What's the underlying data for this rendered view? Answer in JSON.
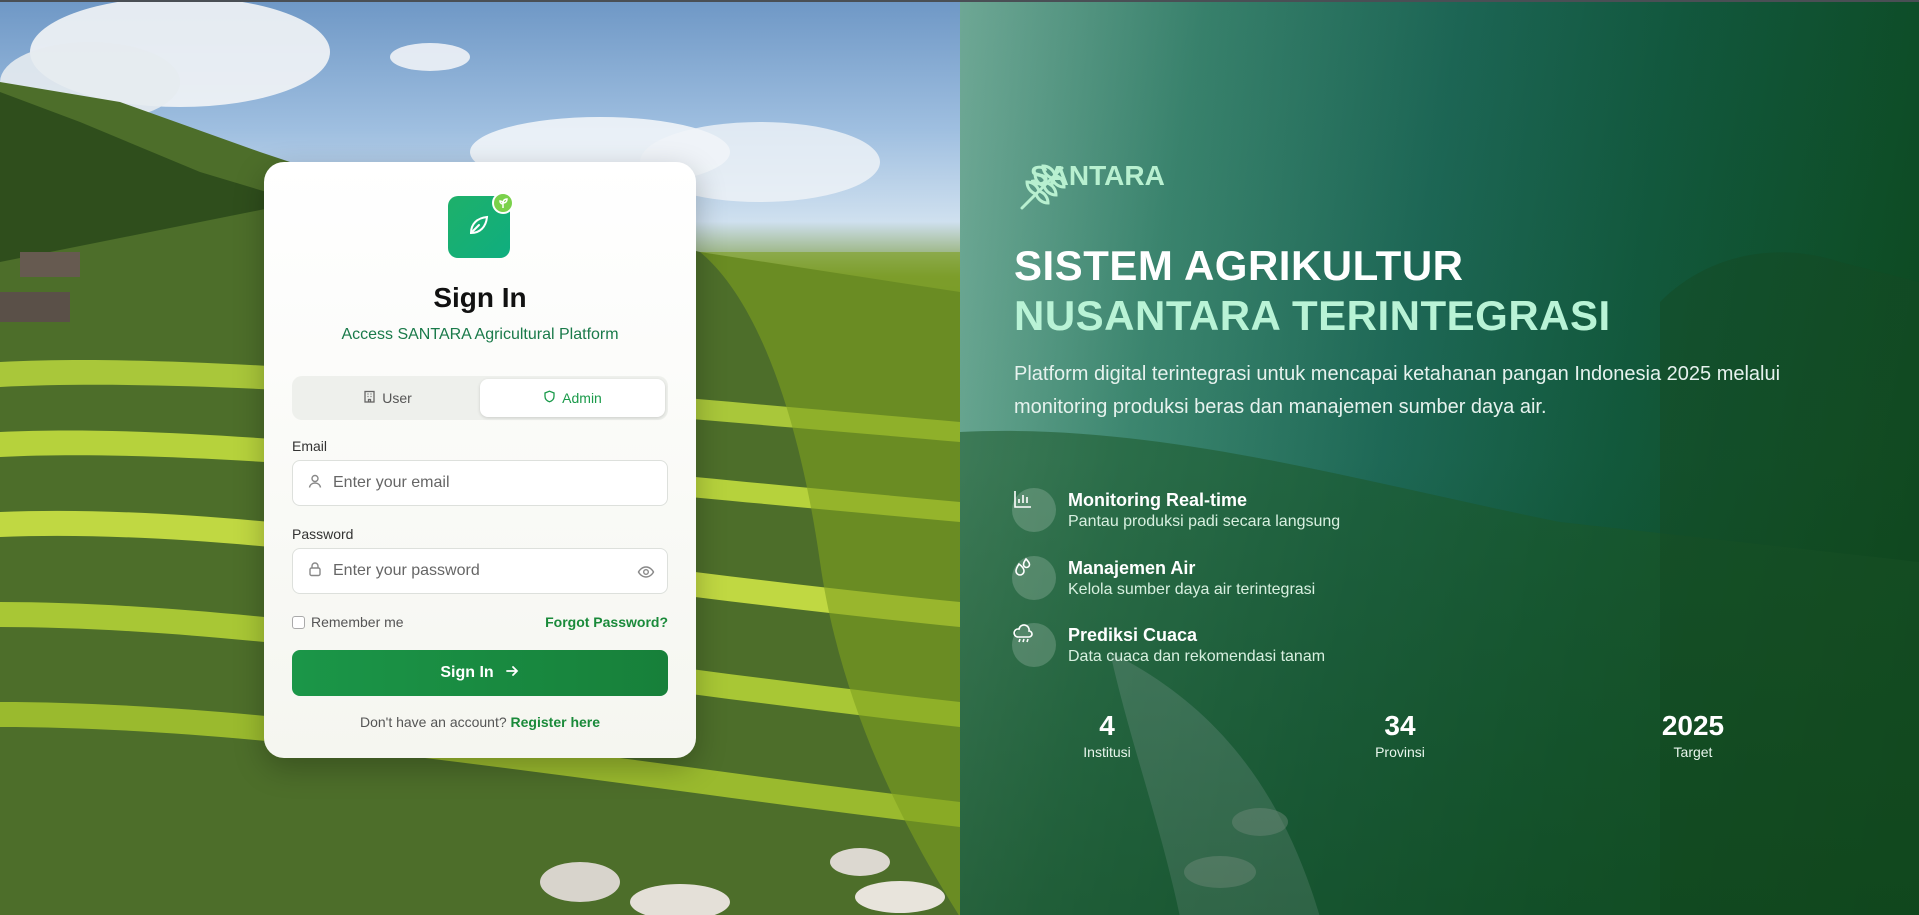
{
  "card": {
    "title": "Sign In",
    "subtitle": "Access SANTARA Agricultural Platform",
    "tabs": [
      {
        "label": "User",
        "icon": "building-icon",
        "active": false
      },
      {
        "label": "Admin",
        "icon": "shield-icon",
        "active": true
      }
    ],
    "email": {
      "label": "Email",
      "placeholder": "Enter your email"
    },
    "password": {
      "label": "Password",
      "placeholder": "Enter your password"
    },
    "remember": "Remember me",
    "forgot": "Forgot Password?",
    "signin": "Sign In",
    "register_prompt": "Don't have an account?",
    "register_link": "Register here"
  },
  "hero": {
    "brand": "SANTARA",
    "headline_1": "SISTEM AGRIKULTUR",
    "headline_2": "NUSANTARA TERINTEGRASI",
    "description": "Platform digital terintegrasi untuk mencapai ketahanan pangan Indonesia 2025 melalui monitoring produksi beras dan manajemen sumber daya air.",
    "features": [
      {
        "title": "Monitoring Real-time",
        "subtitle": "Pantau produksi padi secara langsung",
        "icon": "bar-chart-icon"
      },
      {
        "title": "Manajemen Air",
        "subtitle": "Kelola sumber daya air terintegrasi",
        "icon": "droplets-icon"
      },
      {
        "title": "Prediksi Cuaca",
        "subtitle": "Data cuaca dan rekomendasi tanam",
        "icon": "cloud-rain-icon"
      }
    ],
    "stats": [
      {
        "value": "4",
        "label": "Institusi"
      },
      {
        "value": "34",
        "label": "Provinsi"
      },
      {
        "value": "2025",
        "label": "Target"
      }
    ]
  },
  "colors": {
    "primary": "#1b9648",
    "accent": "#b9f3d6",
    "link": "#1a8a3a"
  }
}
